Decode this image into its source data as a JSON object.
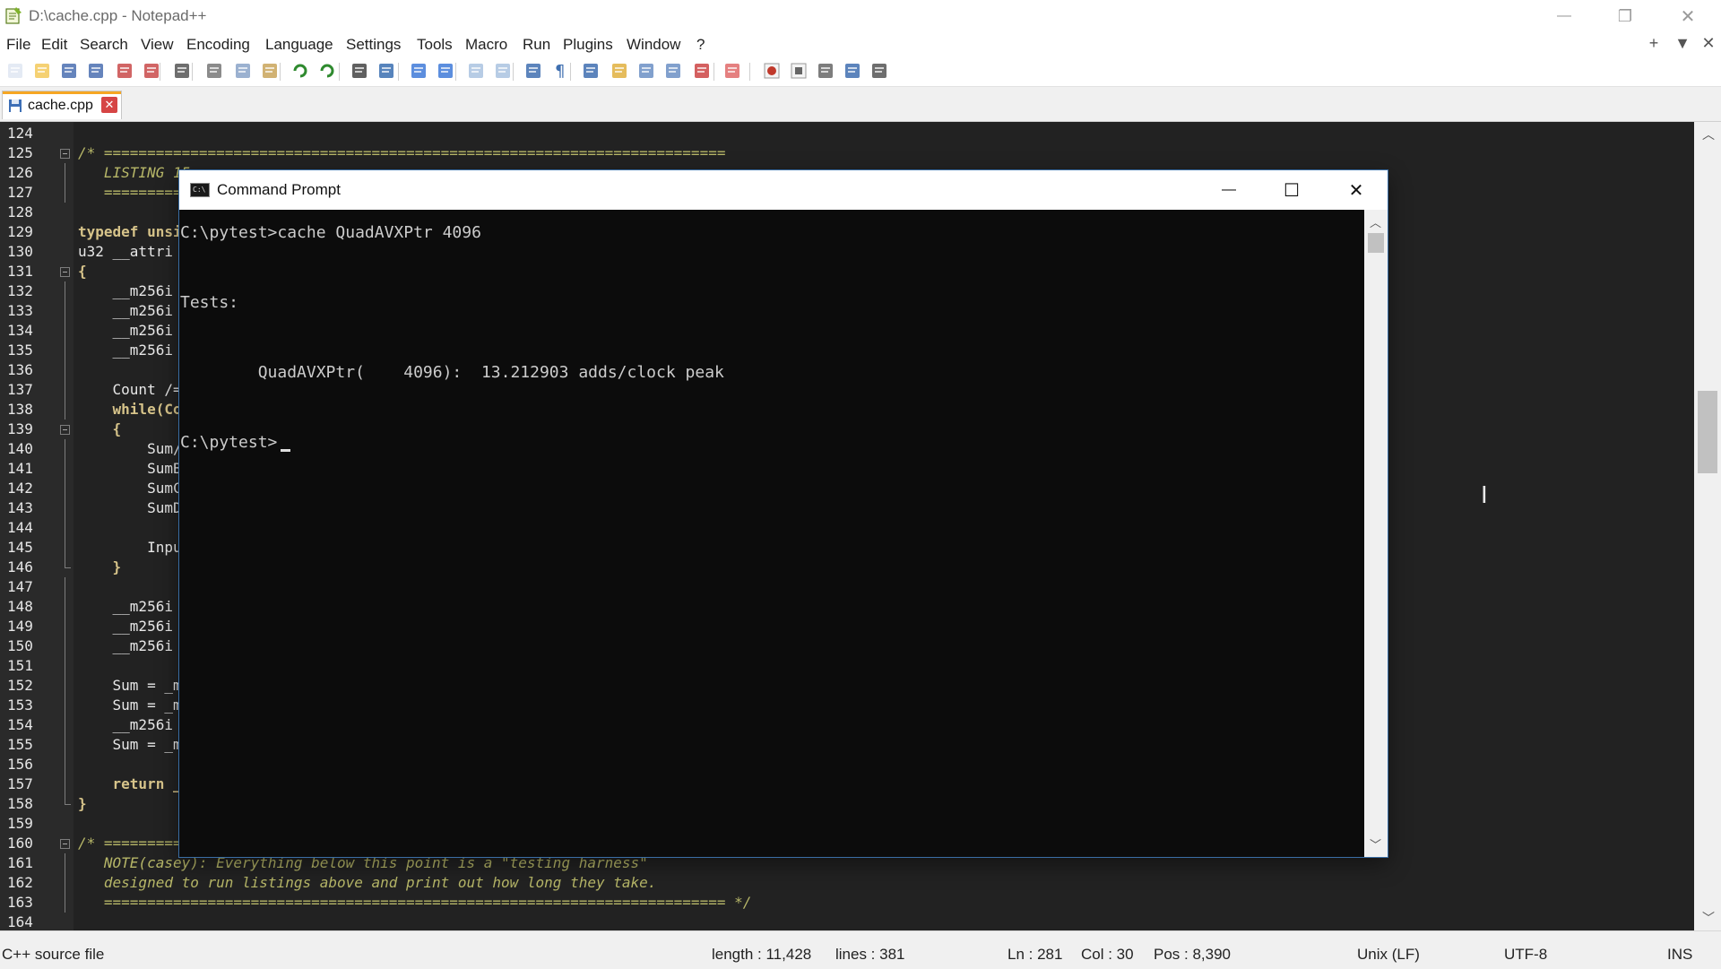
{
  "window": {
    "title": "D:\\cache.cpp - Notepad++",
    "controls": {
      "minimize": "—",
      "restore": "❐",
      "close": "✕"
    }
  },
  "menu": {
    "items": [
      "File",
      "Edit",
      "Search",
      "View",
      "Encoding",
      "Language",
      "Settings",
      "Tools",
      "Macro",
      "Run",
      "Plugins",
      "Window",
      "?"
    ],
    "mdi_controls": [
      "+",
      "▼",
      "✕"
    ]
  },
  "toolbar": {
    "buttons": [
      "new-file",
      "open-file",
      "save",
      "save-all",
      "close",
      "close-all",
      "print",
      "cut",
      "copy",
      "paste",
      "undo",
      "redo",
      "find",
      "replace",
      "zoom-in",
      "zoom-out",
      "sync-vertical",
      "sync-horizontal",
      "word-wrap",
      "show-all-characters",
      "indent-guide",
      "user-defined-language",
      "document-map",
      "function-list",
      "folder-as-workspace",
      "monitoring",
      "start-recording",
      "stop-recording",
      "playback",
      "run-macro-multiple",
      "save-macro"
    ]
  },
  "tab": {
    "label": "cache.cpp",
    "close": "✕"
  },
  "editor": {
    "lines": [
      {
        "n": "124",
        "text": "",
        "style": "plain"
      },
      {
        "n": "125",
        "text": "/* ========================================================================",
        "style": "comment",
        "fold": "box"
      },
      {
        "n": "126",
        "text": "   LISTING 15",
        "style": "comment",
        "fold": "line"
      },
      {
        "n": "127",
        "text": "   =========",
        "style": "comment",
        "fold": "line"
      },
      {
        "n": "128",
        "text": "",
        "style": "plain"
      },
      {
        "n": "129",
        "text": "typedef unsi",
        "style": "kw"
      },
      {
        "n": "130",
        "text": "u32 __attri",
        "style": "plain"
      },
      {
        "n": "131",
        "text": "{",
        "style": "kw",
        "fold": "box"
      },
      {
        "n": "132",
        "text": "    __m256i",
        "style": "plain",
        "fold": "line"
      },
      {
        "n": "133",
        "text": "    __m256i",
        "style": "plain",
        "fold": "line"
      },
      {
        "n": "134",
        "text": "    __m256i",
        "style": "plain",
        "fold": "line"
      },
      {
        "n": "135",
        "text": "    __m256i",
        "style": "plain",
        "fold": "line"
      },
      {
        "n": "136",
        "text": "",
        "style": "plain",
        "fold": "line"
      },
      {
        "n": "137",
        "text": "    Count /=",
        "style": "plain",
        "fold": "line"
      },
      {
        "n": "138",
        "text": "    while(Co",
        "style": "kw",
        "fold": "line"
      },
      {
        "n": "139",
        "text": "    {",
        "style": "kw",
        "fold": "box"
      },
      {
        "n": "140",
        "text": "        Sum/",
        "style": "plain",
        "fold": "line"
      },
      {
        "n": "141",
        "text": "        SumB",
        "style": "plain",
        "fold": "line"
      },
      {
        "n": "142",
        "text": "        SumC",
        "style": "plain",
        "fold": "line"
      },
      {
        "n": "143",
        "text": "        SumD",
        "style": "plain",
        "fold": "line"
      },
      {
        "n": "144",
        "text": "",
        "style": "plain",
        "fold": "line"
      },
      {
        "n": "145",
        "text": "        Inpu",
        "style": "plain",
        "fold": "line"
      },
      {
        "n": "146",
        "text": "    }",
        "style": "kw",
        "fold": "end"
      },
      {
        "n": "147",
        "text": "",
        "style": "plain",
        "fold": "line"
      },
      {
        "n": "148",
        "text": "    __m256i",
        "style": "plain",
        "fold": "line"
      },
      {
        "n": "149",
        "text": "    __m256i",
        "style": "plain",
        "fold": "line"
      },
      {
        "n": "150",
        "text": "    __m256i",
        "style": "plain",
        "fold": "line"
      },
      {
        "n": "151",
        "text": "",
        "style": "plain",
        "fold": "line"
      },
      {
        "n": "152",
        "text": "    Sum = _m",
        "style": "plain",
        "fold": "line"
      },
      {
        "n": "153",
        "text": "    Sum = _m",
        "style": "plain",
        "fold": "line"
      },
      {
        "n": "154",
        "text": "    __m256i",
        "style": "plain",
        "fold": "line"
      },
      {
        "n": "155",
        "text": "    Sum = _m",
        "style": "plain",
        "fold": "line"
      },
      {
        "n": "156",
        "text": "",
        "style": "plain",
        "fold": "line"
      },
      {
        "n": "157",
        "text": "    return _",
        "style": "kw",
        "fold": "line"
      },
      {
        "n": "158",
        "text": "}",
        "style": "kw",
        "fold": "end"
      },
      {
        "n": "159",
        "text": "",
        "style": "plain"
      },
      {
        "n": "160",
        "text": "/* =========",
        "style": "comment",
        "fold": "box"
      },
      {
        "n": "161",
        "text": "   NOTE(casey): Everything below this point is a \"testing harness\"",
        "style": "comment",
        "fold": "line"
      },
      {
        "n": "162",
        "text": "   designed to run listings above and print out how long they take.",
        "style": "comment",
        "fold": "line"
      },
      {
        "n": "163",
        "text": "   ======================================================================== */",
        "style": "comment",
        "fold": "line"
      },
      {
        "n": "164",
        "text": "",
        "style": "plain"
      }
    ]
  },
  "status": {
    "file_type": "C++ source file",
    "length": "length : 11,428",
    "lines": "lines : 381",
    "ln": "Ln : 281",
    "col": "Col : 30",
    "pos": "Pos : 8,390",
    "eol": "Unix (LF)",
    "encoding": "UTF-8",
    "mode": "INS"
  },
  "cmd": {
    "title": "Command Prompt",
    "icon_text": "C:\\",
    "lines": [
      "C:\\pytest>cache QuadAVXPtr 4096",
      "",
      "Tests:",
      "",
      "        QuadAVXPtr(    4096):  13.212903 adds/clock peak",
      "",
      "C:\\pytest>"
    ],
    "controls": {
      "minimize": "—",
      "maximize": "☐",
      "close": "✕"
    }
  },
  "cursor": {
    "glyph": "I"
  }
}
